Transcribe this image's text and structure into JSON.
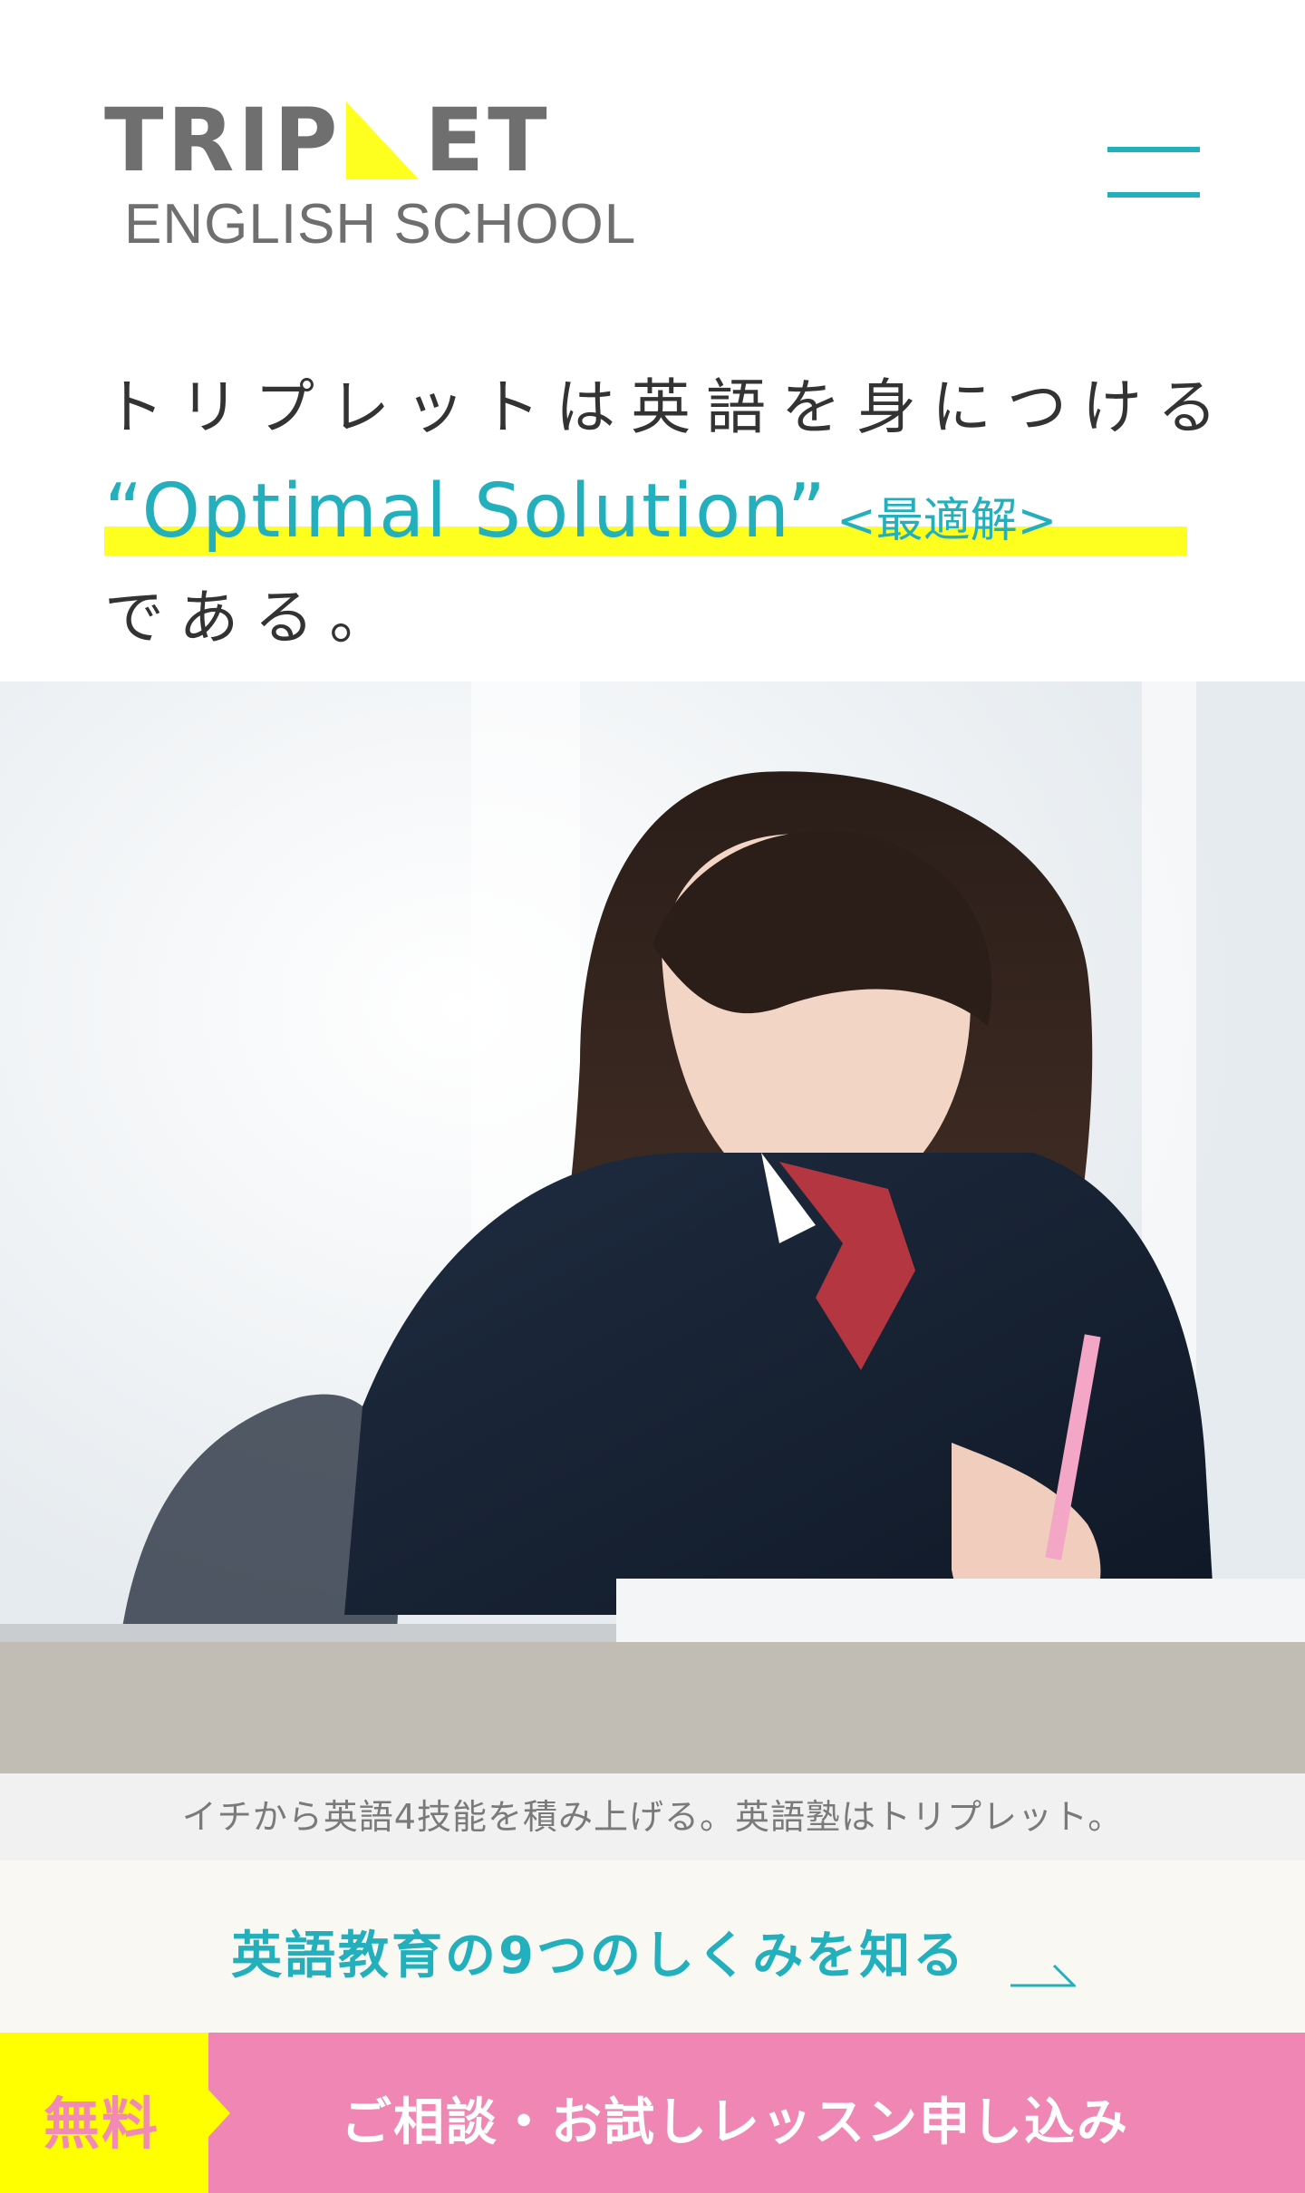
{
  "header": {
    "logo_top_left": "TRIP",
    "logo_top_right": "ET",
    "logo_bottom": "ENGLISH SCHOOL",
    "menu_icon": "hamburger-icon"
  },
  "hero": {
    "line1": "トリプレットは英語を身につける",
    "optimal": "“Optimal Solution”",
    "saiteki": "<最適解>",
    "line3": "である。"
  },
  "caption": "イチから英語4技能を積み上げる。英語塾はトリプレット。",
  "learn_more": {
    "label": "英語教育の9つのしくみを知る",
    "icon": "arrow-right-icon"
  },
  "cta": {
    "free_label": "無料",
    "main_label": "ご相談・お試しレッスン申し込み"
  },
  "colors": {
    "accent_teal": "#23b0bc",
    "highlight_yellow": "#ffff1f",
    "cta_pink": "#ef86b3",
    "cta_yellow": "#ffff00",
    "logo_gray": "#6f6f6f"
  }
}
